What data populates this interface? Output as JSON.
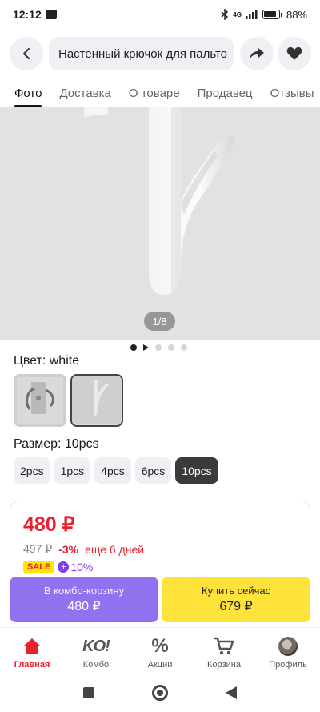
{
  "status_bar": {
    "time": "12:12",
    "network": "4G",
    "battery": "88%"
  },
  "header": {
    "search_text": "Настенный крючок для пальто",
    "icons": [
      "chevron-left-icon",
      "share-arrow-icon",
      "heart-icon"
    ]
  },
  "tabs": [
    {
      "label": "Фото",
      "active": true
    },
    {
      "label": "Доставка",
      "active": false
    },
    {
      "label": "О товаре",
      "active": false
    },
    {
      "label": "Продавец",
      "active": false
    },
    {
      "label": "Отзывы",
      "active": false
    }
  ],
  "gallery": {
    "counter": "1/8"
  },
  "color": {
    "label": "Цвет: white",
    "swatches": [
      "chrome-hook-photo",
      "white-hook-photo"
    ],
    "selected_index": 1
  },
  "size": {
    "label": "Размер: 10pcs",
    "options": [
      "2pcs",
      "1pcs",
      "4pcs",
      "6pcs",
      "10pcs"
    ],
    "selected_index": 4
  },
  "price": {
    "current": "480 ₽",
    "old": "497 ₽",
    "discount": "-3%",
    "timer": "еще 6 дней",
    "sale_badge": "SALE",
    "bonus": "10%"
  },
  "actions": {
    "combo_label": "В комбо-корзину",
    "combo_price": "480 ₽",
    "buy_label": "Купить сейчас",
    "buy_price": "679 ₽"
  },
  "bottom_nav": [
    {
      "label": "Главная",
      "icon": "home-icon",
      "active": true
    },
    {
      "label": "Комбо",
      "icon": "ko-logo-icon",
      "active": false
    },
    {
      "label": "Акции",
      "icon": "percent-icon",
      "active": false
    },
    {
      "label": "Корзина",
      "icon": "cart-icon",
      "active": false
    },
    {
      "label": "Профиль",
      "icon": "avatar-icon",
      "active": false
    }
  ],
  "colors": {
    "accent_red": "#e8222e",
    "combo_purple": "#9173f2",
    "buy_yellow": "#ffe23a"
  }
}
